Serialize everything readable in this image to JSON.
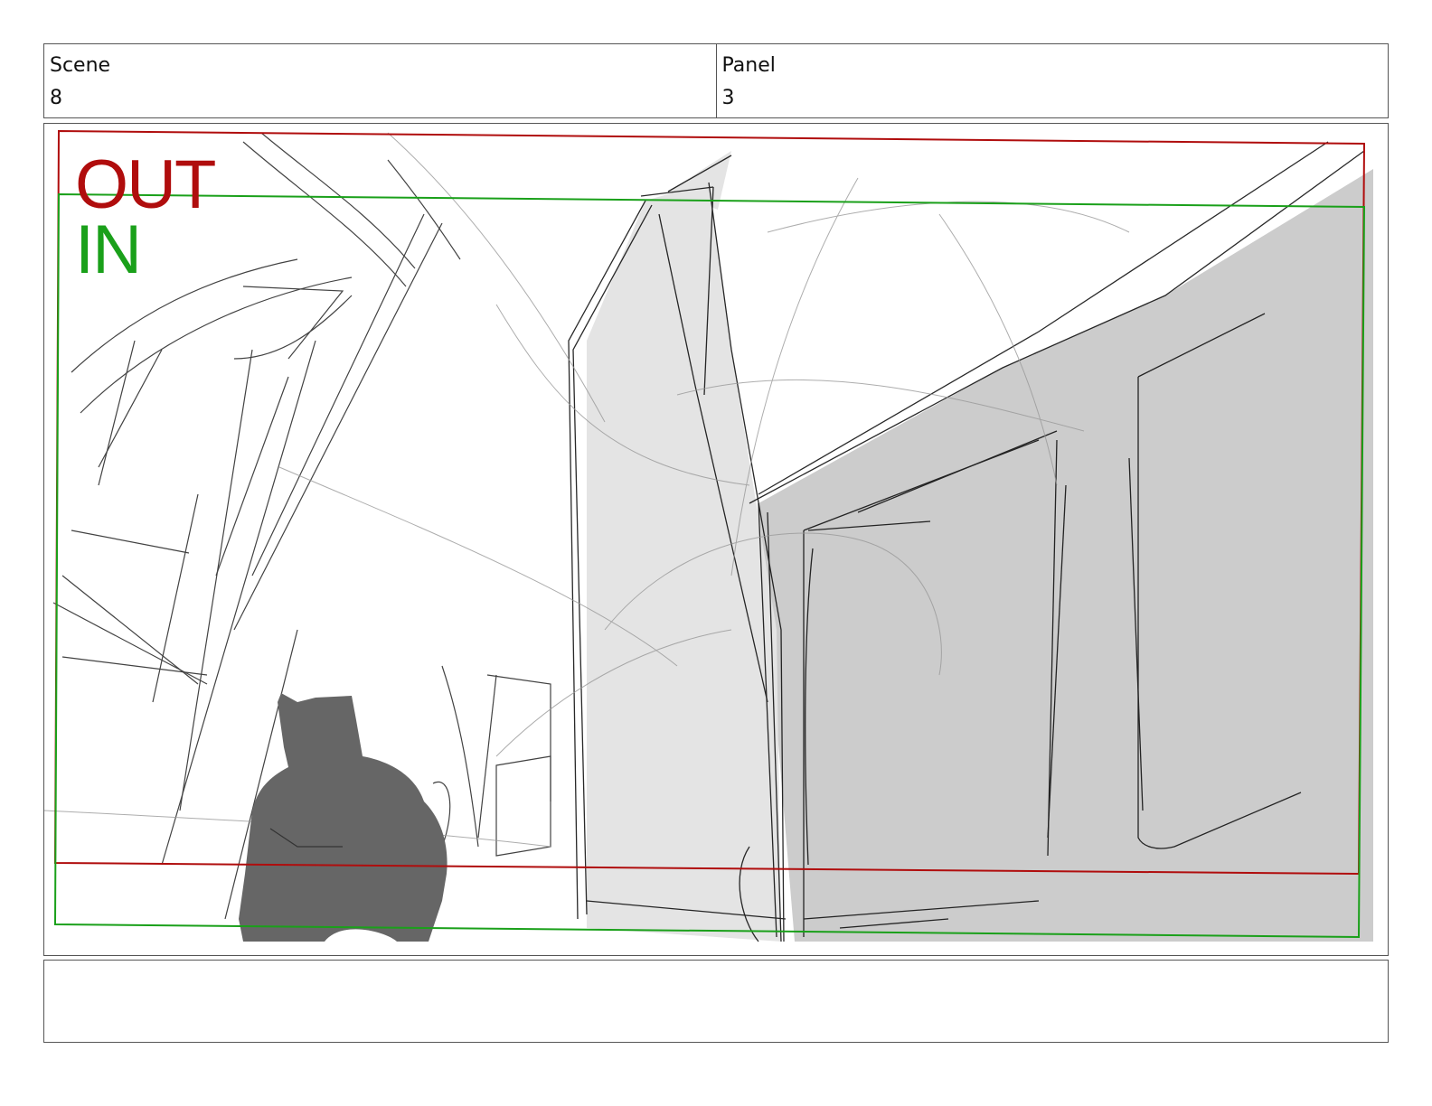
{
  "header": {
    "scene_label": "Scene",
    "scene_value": "8",
    "panel_label": "Panel",
    "panel_value": "3"
  },
  "frame": {
    "out_label": "OUT",
    "in_label": "IN",
    "out_color": "#b00d0d",
    "in_color": "#1aa01a",
    "figure_color": "#666666",
    "wall_light": "#e4e4e4",
    "wall_dark": "#cccccc"
  },
  "notes": {
    "text": ""
  }
}
